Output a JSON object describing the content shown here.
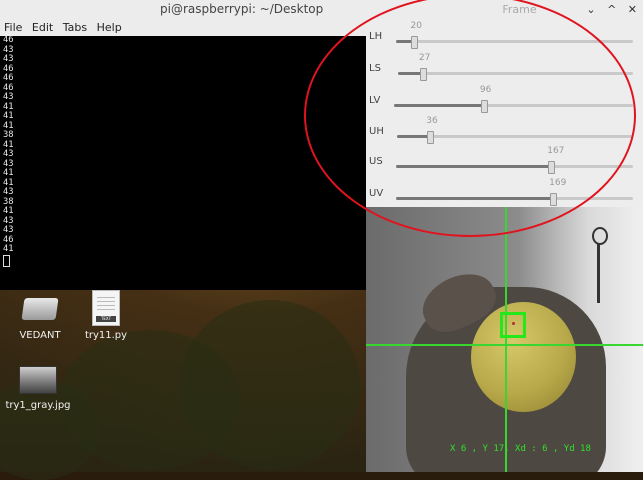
{
  "terminal": {
    "title": "pi@raspberrypi: ~/Desktop",
    "menu": [
      "File",
      "Edit",
      "Tabs",
      "Help"
    ],
    "lines": [
      "46",
      "43",
      "43",
      "46",
      "46",
      "46",
      "43",
      "41",
      "41",
      "41",
      "38",
      "41",
      "43",
      "43",
      "41",
      "41",
      "43",
      "38",
      "41",
      "43",
      "43",
      "46",
      "41"
    ]
  },
  "frame_window": {
    "title": "Frame",
    "controls": [
      "⌄",
      "^",
      "✕"
    ],
    "trackbars": [
      {
        "label": "LH",
        "value": 20,
        "fraction": 0.078
      },
      {
        "label": "LS",
        "value": 27,
        "fraction": 0.106
      },
      {
        "label": "LV",
        "value": 96,
        "fraction": 0.376
      },
      {
        "label": "UH",
        "value": 36,
        "fraction": 0.141
      },
      {
        "label": "US",
        "value": 167,
        "fraction": 0.655
      },
      {
        "label": "UV",
        "value": 169,
        "fraction": 0.663
      }
    ]
  },
  "camera": {
    "overlay_text": "X 6 , Y 17, Xd : 6 , Yd 18",
    "crosshair_color": "#38d62f"
  },
  "desktop_icons": [
    {
      "label": "VEDANT",
      "icon": "drive-icon"
    },
    {
      "label": "try11.py",
      "icon": "text-file-icon",
      "tag": "TEXT"
    },
    {
      "label": "try1_gray.jpg",
      "icon": "image-file-icon"
    }
  ],
  "annotation_color": "#e0141e"
}
